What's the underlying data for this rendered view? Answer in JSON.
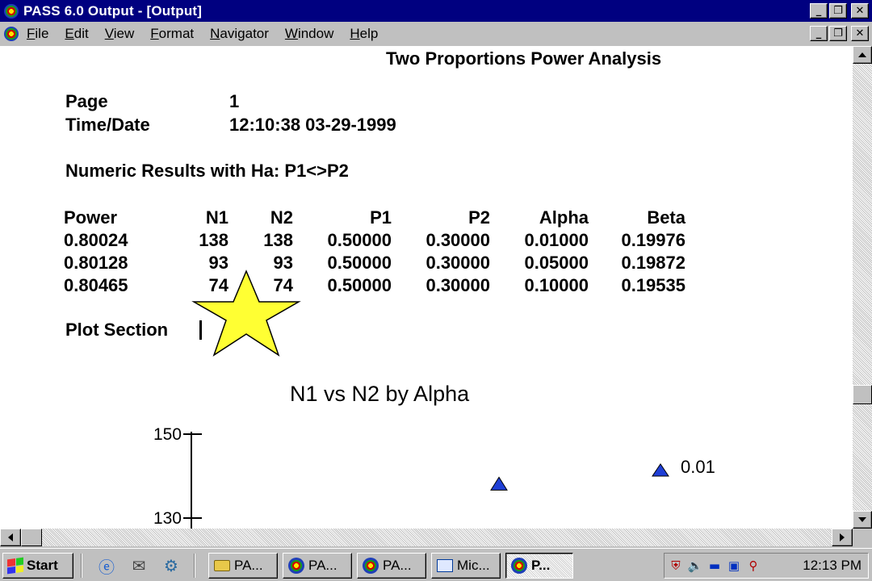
{
  "window": {
    "title": "PASS 6.0 Output - [Output]"
  },
  "menu": {
    "items": [
      {
        "pre": "",
        "u": "F",
        "post": "ile"
      },
      {
        "pre": "",
        "u": "E",
        "post": "dit"
      },
      {
        "pre": "",
        "u": "V",
        "post": "iew"
      },
      {
        "pre": "",
        "u": "F",
        "post": "ormat"
      },
      {
        "pre": "",
        "u": "N",
        "post": "avigator"
      },
      {
        "pre": "",
        "u": "W",
        "post": "indow"
      },
      {
        "pre": "",
        "u": "H",
        "post": "elp"
      }
    ]
  },
  "report": {
    "title": "Two Proportions Power Analysis",
    "page_label": "Page",
    "page_value": "1",
    "time_label": "Time/Date",
    "time_value": "12:10:38 03-29-1999",
    "numeric_heading": "Numeric Results with Ha: P1<>P2",
    "columns": [
      "Power",
      "N1",
      "N2",
      "P1",
      "P2",
      "Alpha",
      "Beta"
    ],
    "rows": [
      [
        "0.80024",
        "138",
        "138",
        "0.50000",
        "0.30000",
        "0.01000",
        "0.19976"
      ],
      [
        "0.80128",
        "93",
        "93",
        "0.50000",
        "0.30000",
        "0.05000",
        "0.19872"
      ],
      [
        "0.80465",
        "74",
        "74",
        "0.50000",
        "0.30000",
        "0.10000",
        "0.19535"
      ]
    ],
    "plot_heading": "Plot Section"
  },
  "chart_data": {
    "type": "scatter",
    "title": "N1 vs N2 by Alpha",
    "xlabel": "",
    "ylabel": "",
    "y_ticks": [
      "150",
      "130"
    ],
    "series": [
      {
        "name": "0.01",
        "color": "#1f3fd6",
        "marker": "triangle",
        "points": [
          {
            "x": 138,
            "y": 138
          }
        ]
      }
    ],
    "legend": "right"
  },
  "taskbar": {
    "start_label": "Start",
    "tasks": [
      {
        "label": "PA...",
        "icon": "folder-icon"
      },
      {
        "label": "PA...",
        "icon": "pass-app-icon"
      },
      {
        "label": "PA...",
        "icon": "pass-app-icon"
      },
      {
        "label": "Mic...",
        "icon": "microsoft-app-icon"
      },
      {
        "label": "P...",
        "icon": "pass-app-icon"
      }
    ],
    "clock": "12:13 PM"
  },
  "colors": {
    "titlebar": "#000080",
    "marker": "#1f3fd6",
    "star": "#ffff33"
  }
}
